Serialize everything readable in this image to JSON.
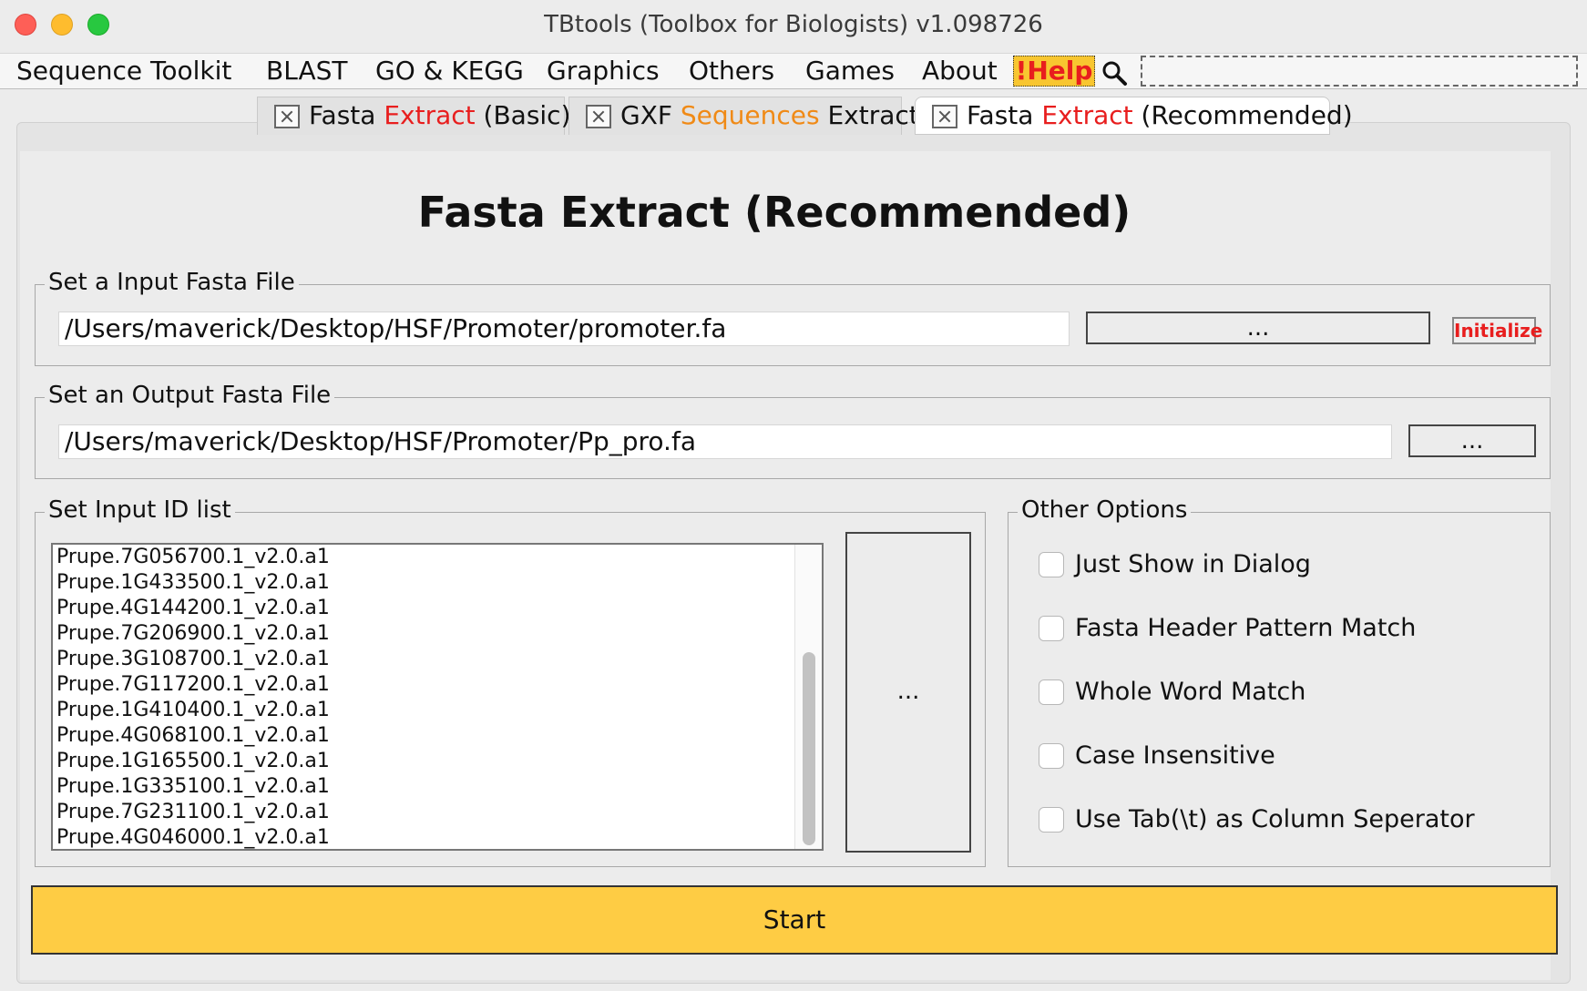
{
  "window": {
    "title": "TBtools (Toolbox for Biologists) v1.098726"
  },
  "menu": {
    "items": [
      "Sequence Toolkit",
      "BLAST",
      "GO & KEGG",
      "Graphics",
      "Others",
      "Games",
      "About"
    ],
    "help": "!Help",
    "search_icon": "magnifier-icon",
    "search_value": ""
  },
  "tabs": [
    {
      "pre": "Fasta ",
      "accent": "Extract",
      "post": " (Basic)",
      "accent_color": "#e81e1e"
    },
    {
      "pre": "GXF ",
      "accent": "Sequences",
      "post": " Extract",
      "accent_color": "#f08a16"
    },
    {
      "pre": "Fasta ",
      "accent": "Extract",
      "post": " (Recommended)",
      "accent_color": "#e81e1e"
    }
  ],
  "main": {
    "heading": "Fasta Extract (Recommended)",
    "input_group": {
      "legend": "Set a Input Fasta File",
      "path": "/Users/maverick/Desktop/HSF/Promoter/promoter.fa",
      "browse_label": "...",
      "initialize_label": "Initialize"
    },
    "output_group": {
      "legend": "Set an Output Fasta File",
      "path": "/Users/maverick/Desktop/HSF/Promoter/Pp_pro.fa",
      "browse_label": "..."
    },
    "id_group": {
      "legend": "Set Input ID list",
      "ids": [
        "Prupe.7G056700.1_v2.0.a1",
        "Prupe.1G433500.1_v2.0.a1",
        "Prupe.4G144200.1_v2.0.a1",
        "Prupe.7G206900.1_v2.0.a1",
        "Prupe.3G108700.1_v2.0.a1",
        "Prupe.7G117200.1_v2.0.a1",
        "Prupe.1G410400.1_v2.0.a1",
        "Prupe.4G068100.1_v2.0.a1",
        "Prupe.1G165500.1_v2.0.a1",
        "Prupe.1G335100.1_v2.0.a1",
        "Prupe.7G231100.1_v2.0.a1",
        "Prupe.4G046000.1_v2.0.a1"
      ],
      "browse_label": "..."
    },
    "options_group": {
      "legend": "Other Options",
      "options": [
        {
          "label": "Just Show in Dialog",
          "checked": false
        },
        {
          "label": "Fasta Header Pattern Match",
          "checked": false
        },
        {
          "label": "Whole Word Match",
          "checked": false
        },
        {
          "label": "Case Insensitive",
          "checked": false
        },
        {
          "label": "Use Tab(\\t) as Column Seperator",
          "checked": false
        }
      ]
    },
    "start_label": "Start"
  },
  "colors": {
    "start_button": "#fecc44",
    "help_bg": "#f8c630",
    "accent_red": "#e81e1e",
    "accent_orange": "#f08a16"
  }
}
